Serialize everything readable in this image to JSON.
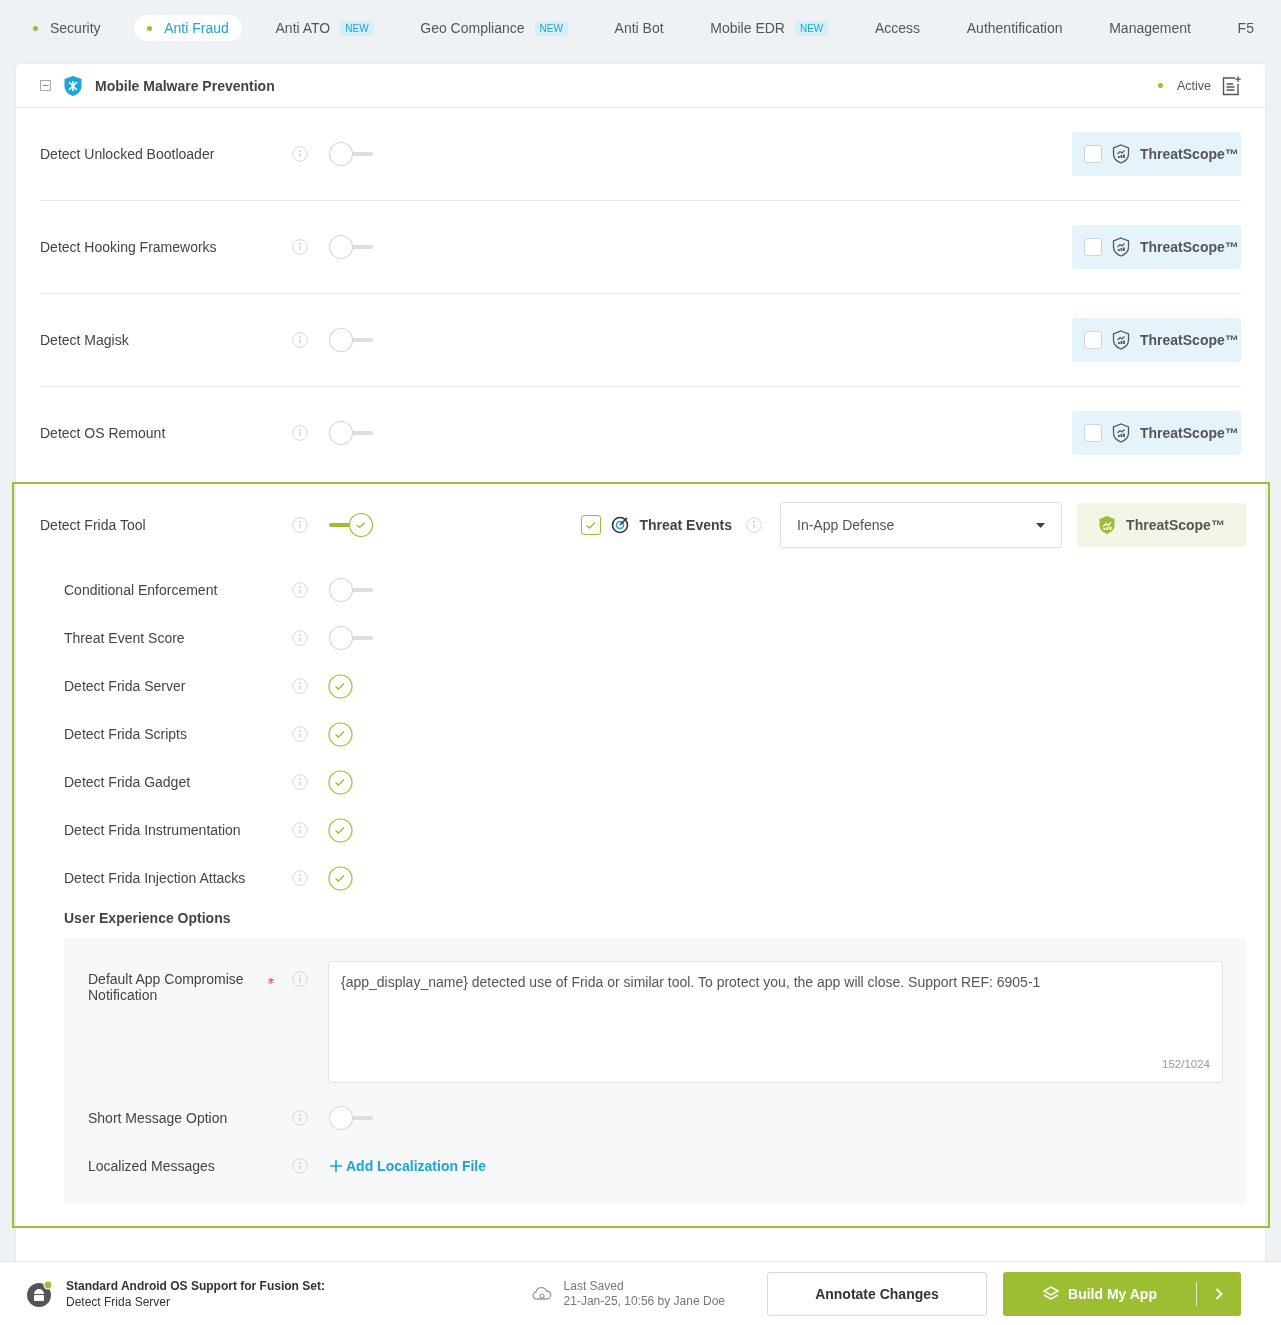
{
  "tabs": [
    {
      "label": "Security",
      "dot": true,
      "selected": false
    },
    {
      "label": "Anti Fraud",
      "dot": true,
      "selected": true
    },
    {
      "label": "Anti ATO",
      "dot": false,
      "badge": "NEW",
      "selected": false
    },
    {
      "label": "Geo Compliance",
      "dot": false,
      "badge": "NEW",
      "selected": false
    },
    {
      "label": "Anti Bot",
      "dot": false,
      "selected": false
    },
    {
      "label": "Mobile EDR",
      "dot": false,
      "badge": "NEW",
      "selected": false
    },
    {
      "label": "Access",
      "dot": false,
      "selected": false
    },
    {
      "label": "Authentification",
      "dot": false,
      "selected": false
    },
    {
      "label": "Management",
      "dot": false,
      "selected": false
    },
    {
      "label": "F5",
      "dot": false,
      "selected": false
    }
  ],
  "section": {
    "title": "Mobile Malware Prevention",
    "expanded": true,
    "status": "Active"
  },
  "rows": [
    {
      "label": "Detect Unlocked Bootloader",
      "enabled": false,
      "threatscope_checked": false,
      "threatscope": "ThreatScope™"
    },
    {
      "label": "Detect Hooking Frameworks",
      "enabled": false,
      "threatscope_checked": false,
      "threatscope": "ThreatScope™"
    },
    {
      "label": "Detect Magisk",
      "enabled": false,
      "threatscope_checked": false,
      "threatscope": "ThreatScope™"
    },
    {
      "label": "Detect OS Remount",
      "enabled": false,
      "threatscope_checked": false,
      "threatscope": "ThreatScope™"
    }
  ],
  "frida": {
    "label": "Detect Frida Tool",
    "enabled": true,
    "threat_events_checked": true,
    "threat_events": "Threat Events",
    "dropdown": "In-App Defense",
    "threatscope": "ThreatScope™",
    "threatscope_active": true,
    "sub_options": [
      {
        "label": "Conditional Enforcement",
        "kind": "switch",
        "on": false
      },
      {
        "label": "Threat Event Score",
        "kind": "switch",
        "on": false
      },
      {
        "label": "Detect Frida Server",
        "kind": "check",
        "on": true
      },
      {
        "label": "Detect Frida Scripts",
        "kind": "check",
        "on": true
      },
      {
        "label": "Detect Frida Gadget",
        "kind": "check",
        "on": true
      },
      {
        "label": "Detect Frida Instrumentation",
        "kind": "check",
        "on": true
      },
      {
        "label": "Detect Frida Injection Attacks",
        "kind": "check",
        "on": true
      }
    ],
    "ux_heading": "User Experience Options",
    "notification": {
      "label": "Default App Compromise Notification",
      "required": true,
      "value": "{app_display_name} detected use of Frida or similar tool. To protect you, the app will close. Support REF: 6905-1",
      "counter": "152/1024"
    },
    "short_message": {
      "label": "Short Message Option",
      "on": false
    },
    "localized": {
      "label": "Localized Messages",
      "link": "Add Localization File"
    }
  },
  "footer": {
    "title": "Standard Android OS Support for Fusion Set:",
    "subtitle": "Detect Frida Server",
    "saved_label": "Last Saved",
    "saved_value": "21-Jan-25, 10:56 by Jane Doe",
    "annotate": "Annotate Changes",
    "build": "Build My App"
  }
}
